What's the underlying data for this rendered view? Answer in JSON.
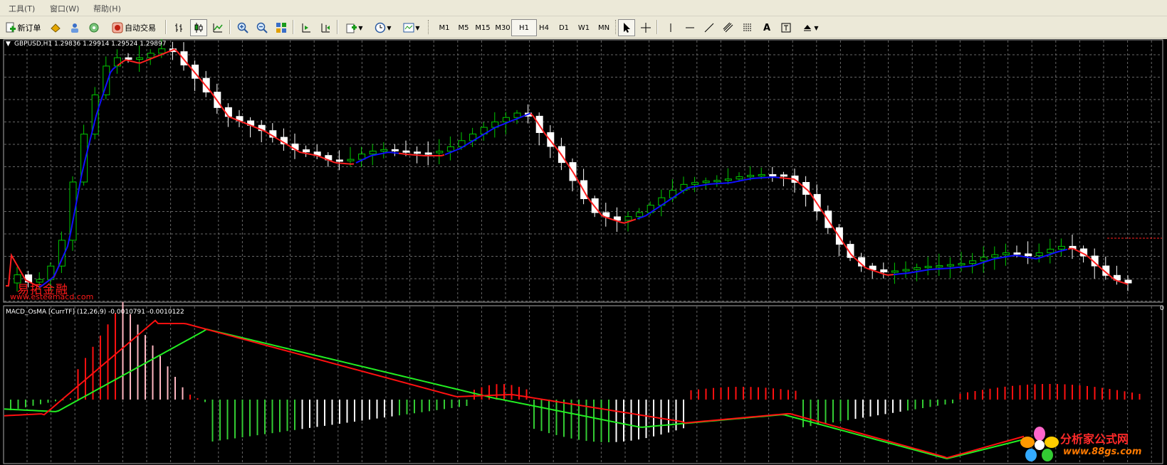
{
  "menu": {
    "tools": "工具(T)",
    "window": "窗口(W)",
    "help": "帮助(H)"
  },
  "toolbar": {
    "new_order": "新订单",
    "auto_trade": "自动交易",
    "timeframes": [
      "M1",
      "M5",
      "M15",
      "M30",
      "H1",
      "H4",
      "D1",
      "W1",
      "MN"
    ],
    "selected_timeframe": "H1",
    "text_tool": "A"
  },
  "chart": {
    "symbol_label": "GBPUSD,H1  1.29836 1.29914 1.29524 1.29897",
    "indicator_label": "MACD_OsMA [CurrTF] (12,26,9) -0.0010791 -0.0010122",
    "indicator_scale_zero": "0",
    "watermark_cn": "易拓金融",
    "watermark_url": "www.esteemacd.com"
  },
  "logo": {
    "name": "分析家公式网",
    "url": "www.88gs.com"
  },
  "colors": {
    "bull": "#00c800",
    "bear": "#ffffff",
    "ma_up": "#1010ff",
    "ma_down": "#ff2020",
    "grid": "#666666",
    "macd_red": "#ff1010",
    "macd_pink": "#ffb6c1",
    "macd_green": "#33cc33",
    "signal_green": "#22ee22"
  }
}
